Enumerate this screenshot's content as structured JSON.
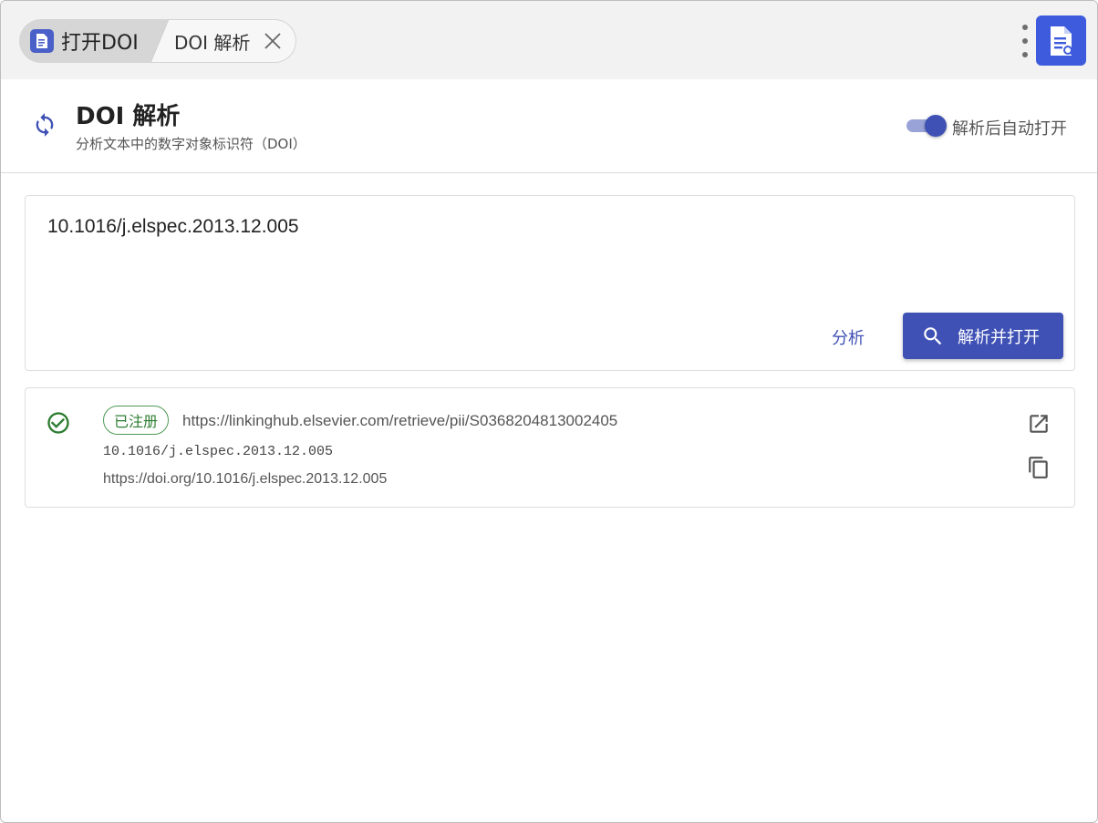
{
  "tabs": {
    "app_label": "打开DOI",
    "doi_label": "DOI 解析"
  },
  "header": {
    "title": "DOI 解析",
    "subtitle": "分析文本中的数字对象标识符（DOI）",
    "auto_open_label": "解析后自动打开",
    "auto_open_enabled": true
  },
  "input": {
    "value": "10.1016/j.elspec.2013.12.005",
    "analyze_label": "分析",
    "resolve_label": "解析并打开"
  },
  "result": {
    "status": "已注册",
    "url": "https://linkinghub.elsevier.com/retrieve/pii/S0368204813002405",
    "doi": "10.1016/j.elspec.2013.12.005",
    "doi_url": "https://doi.org/10.1016/j.elspec.2013.12.005"
  },
  "colors": {
    "accent": "#3f51b5",
    "success": "#2e7d32",
    "tabbar_bg": "#f2f2f2"
  },
  "icons": {
    "app": "document-icon",
    "close": "close-icon",
    "menu": "more-vert-icon",
    "refresh": "sync-icon",
    "search": "search-icon",
    "status": "check-circle-icon",
    "open": "open-in-new-icon",
    "copy": "copy-icon"
  }
}
